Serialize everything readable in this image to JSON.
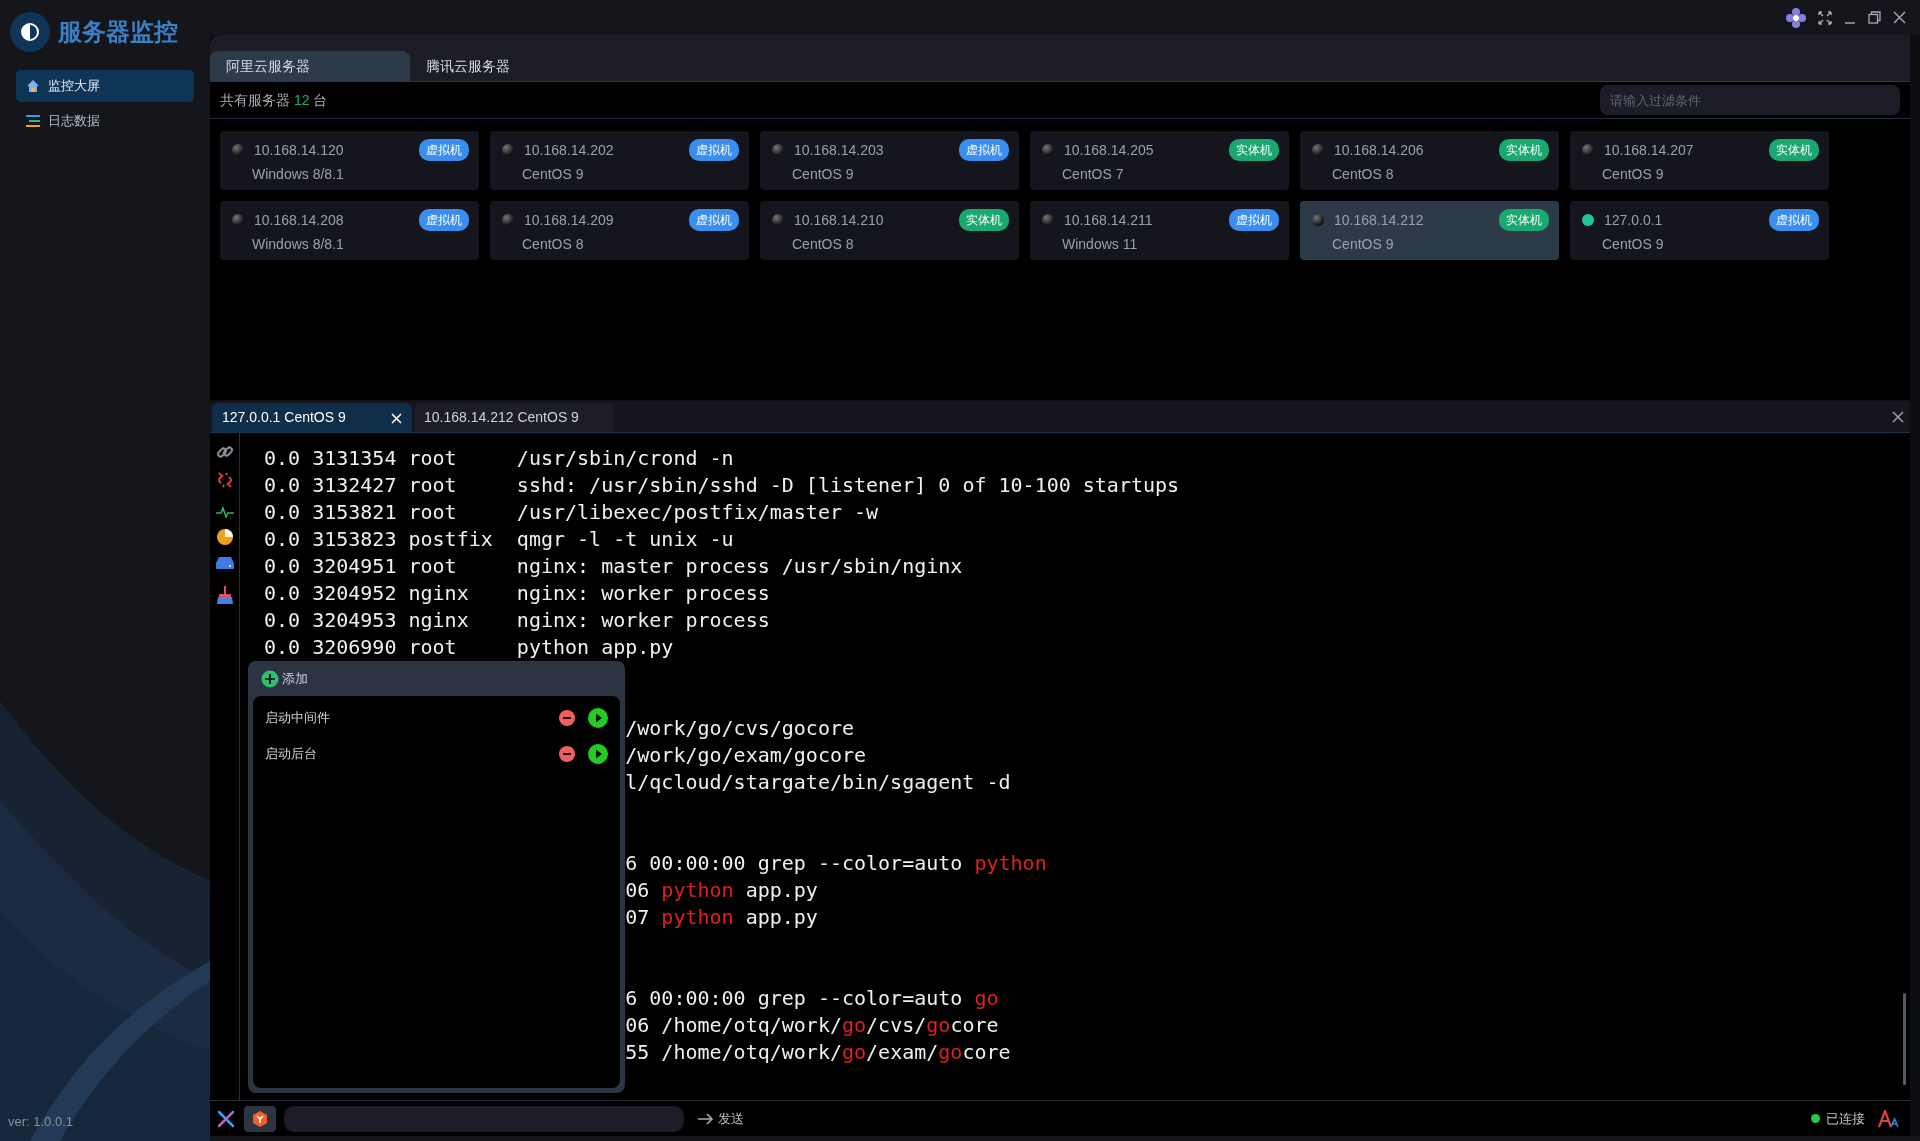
{
  "app": {
    "title": "服务器监控",
    "version": "ver: 1.0.0.1"
  },
  "sidebar": {
    "items": [
      {
        "label": "监控大屏",
        "selected": true
      },
      {
        "label": "日志数据",
        "selected": false
      }
    ]
  },
  "server_tabs": [
    {
      "label": "阿里云服务器",
      "selected": true
    },
    {
      "label": "腾讯云服务器",
      "selected": false
    }
  ],
  "summary": {
    "prefix": "共有服务器",
    "count": "12",
    "suffix": "台"
  },
  "filter": {
    "placeholder": "请输入过滤条件"
  },
  "servers": [
    {
      "ip": "10.168.14.120",
      "os": "Windows 8/8.1",
      "tag": "虚拟机",
      "kind": "virtual",
      "online": false,
      "selected": false
    },
    {
      "ip": "10.168.14.202",
      "os": "CentOS 9",
      "tag": "虚拟机",
      "kind": "virtual",
      "online": false,
      "selected": false
    },
    {
      "ip": "10.168.14.203",
      "os": "CentOS 9",
      "tag": "虚拟机",
      "kind": "virtual",
      "online": false,
      "selected": false
    },
    {
      "ip": "10.168.14.205",
      "os": "CentOS 7",
      "tag": "实体机",
      "kind": "physical",
      "online": false,
      "selected": false
    },
    {
      "ip": "10.168.14.206",
      "os": "CentOS 8",
      "tag": "实体机",
      "kind": "physical",
      "online": false,
      "selected": false
    },
    {
      "ip": "10.168.14.207",
      "os": "CentOS 9",
      "tag": "实体机",
      "kind": "physical",
      "online": false,
      "selected": false
    },
    {
      "ip": "10.168.14.208",
      "os": "Windows 8/8.1",
      "tag": "虚拟机",
      "kind": "virtual",
      "online": false,
      "selected": false
    },
    {
      "ip": "10.168.14.209",
      "os": "CentOS 8",
      "tag": "虚拟机",
      "kind": "virtual",
      "online": false,
      "selected": false
    },
    {
      "ip": "10.168.14.210",
      "os": "CentOS 8",
      "tag": "实体机",
      "kind": "physical",
      "online": false,
      "selected": false
    },
    {
      "ip": "10.168.14.211",
      "os": "Windows 11",
      "tag": "虚拟机",
      "kind": "virtual",
      "online": false,
      "selected": false
    },
    {
      "ip": "10.168.14.212",
      "os": "CentOS 9",
      "tag": "实体机",
      "kind": "physical",
      "online": false,
      "selected": true
    },
    {
      "ip": "127.0.0.1",
      "os": "CentOS 9",
      "tag": "虚拟机",
      "kind": "virtual",
      "online": true,
      "selected": false
    }
  ],
  "terminal_tabs": [
    {
      "label": "127.0.0.1 CentOS 9",
      "selected": true,
      "closable": true
    },
    {
      "label": "10.168.14.212 CentOS 9",
      "selected": false,
      "closable": false
    }
  ],
  "terminal_lines": [
    {
      "kind": "full",
      "segments": [
        {
          "text": "0.0 3131354 root     /usr/sbin/crond -n",
          "highlight": false
        }
      ]
    },
    {
      "kind": "full",
      "segments": [
        {
          "text": "0.0 3132427 root     sshd: /usr/sbin/sshd -D [listener] 0 of 10-100 startups",
          "highlight": false
        }
      ]
    },
    {
      "kind": "full",
      "segments": [
        {
          "text": "0.0 3153821 root     /usr/libexec/postfix/master -w",
          "highlight": false
        }
      ]
    },
    {
      "kind": "full",
      "segments": [
        {
          "text": "0.0 3153823 postfix  qmgr -l -t unix -u",
          "highlight": false
        }
      ]
    },
    {
      "kind": "full",
      "segments": [
        {
          "text": "0.0 3204951 root     nginx: master process /usr/sbin/nginx",
          "highlight": false
        }
      ]
    },
    {
      "kind": "full",
      "segments": [
        {
          "text": "0.0 3204952 nginx    nginx: worker process",
          "highlight": false
        }
      ]
    },
    {
      "kind": "full",
      "segments": [
        {
          "text": "0.0 3204953 nginx    nginx: worker process",
          "highlight": false
        }
      ]
    },
    {
      "kind": "full",
      "segments": [
        {
          "text": "0.0 3206990 root     python app.py",
          "highlight": false
        }
      ]
    },
    {
      "kind": "blank"
    },
    {
      "kind": "blank"
    },
    {
      "kind": "partial",
      "segments": [
        {
          "text": "/work/go/cvs/gocore",
          "highlight": false
        }
      ]
    },
    {
      "kind": "partial",
      "segments": [
        {
          "text": "/work/go/exam/gocore",
          "highlight": false
        }
      ]
    },
    {
      "kind": "partial",
      "segments": [
        {
          "text": "l/qcloud/stargate/bin/sgagent -d",
          "highlight": false
        }
      ]
    },
    {
      "kind": "blank"
    },
    {
      "kind": "blank"
    },
    {
      "kind": "partial",
      "segments": [
        {
          "text": "6 00:00:00 grep --color=auto ",
          "highlight": false
        },
        {
          "text": "python",
          "highlight": true
        }
      ]
    },
    {
      "kind": "partial",
      "segments": [
        {
          "text": "06 ",
          "highlight": false
        },
        {
          "text": "python",
          "highlight": true
        },
        {
          "text": " app.py",
          "highlight": false
        }
      ]
    },
    {
      "kind": "partial",
      "segments": [
        {
          "text": "07 ",
          "highlight": false
        },
        {
          "text": "python",
          "highlight": true
        },
        {
          "text": " app.py",
          "highlight": false
        }
      ]
    },
    {
      "kind": "blank"
    },
    {
      "kind": "blank"
    },
    {
      "kind": "partial",
      "segments": [
        {
          "text": "6 00:00:00 grep --color=auto ",
          "highlight": false
        },
        {
          "text": "go",
          "highlight": true
        }
      ]
    },
    {
      "kind": "partial",
      "segments": [
        {
          "text": "06 /home/otq/work/",
          "highlight": false
        },
        {
          "text": "go",
          "highlight": true
        },
        {
          "text": "/cvs/",
          "highlight": false
        },
        {
          "text": "go",
          "highlight": true
        },
        {
          "text": "core",
          "highlight": false
        }
      ]
    },
    {
      "kind": "partial",
      "segments": [
        {
          "text": "55 /home/otq/work/",
          "highlight": false
        },
        {
          "text": "go",
          "highlight": true
        },
        {
          "text": "/exam/",
          "highlight": false
        },
        {
          "text": "go",
          "highlight": true
        },
        {
          "text": "core",
          "highlight": false
        }
      ]
    }
  ],
  "command_panel": {
    "add_label": "添加",
    "items": [
      {
        "label": "启动中间件"
      },
      {
        "label": "启动后台"
      }
    ]
  },
  "command_bar": {
    "send_label": "发送"
  },
  "status": {
    "connected": true,
    "label": "已连接"
  }
}
